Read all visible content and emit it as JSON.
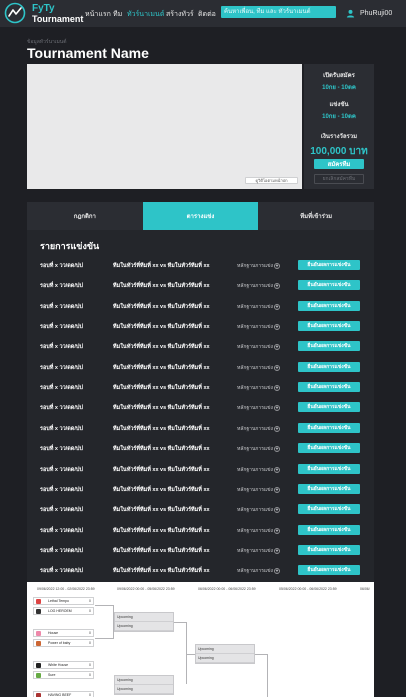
{
  "app": {
    "logo_line1": "FyTy",
    "logo_line2": "Tournament"
  },
  "nav": {
    "items": [
      {
        "label": "หน้าแรก"
      },
      {
        "label": "ทีม"
      },
      {
        "label": "ทัวร์นาเมนต์",
        "active": true
      },
      {
        "label": "สร้างทัวร์"
      },
      {
        "label": "ติดต่อ"
      }
    ],
    "search_placeholder": "ค้นหาเพื่อน, ทีม และ ทัวร์นาเมนต์",
    "username": "PhuRuji00"
  },
  "header": {
    "breadcrumb": "ข้อมูลทัวร์นาเมนต์",
    "title": "Tournament Name"
  },
  "media": {
    "watch_label": "ดูวิดีโอตามหน้าปก"
  },
  "info": {
    "open_label": "เปิดรับสมัคร",
    "open_value": "10กย - 10ตค",
    "compete_label": "แข่งขัน",
    "compete_value": "10กย - 10ตค",
    "prize_label": "เงินรางวัลรวม",
    "prize_value": "100,000 บาท",
    "apply_label": "สมัครทีม",
    "cancel_label": "ยกเลิกสมัครทีม"
  },
  "tabs": [
    {
      "label": "กฎกติกา"
    },
    {
      "label": "ตารางแข่ง",
      "active": true
    },
    {
      "label": "ทีมที่เข้าร่วม"
    }
  ],
  "schedule": {
    "title": "รายการแข่งขัน",
    "rows": [
      {
        "round": "รอบที่ x   วว/ดด/ปป",
        "teams": "ทีมในทัวร์ที่ทีมที่ xx  vs ทีมในทัวร์ทีมที่ xx",
        "evidence": "หลักฐานการแข่ง",
        "action": "ยืนยันผลการแข่งขัน"
      },
      {
        "round": "รอบที่ x   วว/ดด/ปป",
        "teams": "ทีมในทัวร์ที่ทีมที่ xx  vs ทีมในทัวร์ทีมที่ xx",
        "evidence": "หลักฐานการแข่ง",
        "action": "ยืนยันผลการแข่งขัน"
      },
      {
        "round": "รอบที่ x   วว/ดด/ปป",
        "teams": "ทีมในทัวร์ที่ทีมที่ xx  vs ทีมในทัวร์ทีมที่ xx",
        "evidence": "หลักฐานการแข่ง",
        "action": "ยืนยันผลการแข่งขัน"
      },
      {
        "round": "รอบที่ x   วว/ดด/ปป",
        "teams": "ทีมในทัวร์ที่ทีมที่ xx  vs ทีมในทัวร์ทีมที่ xx",
        "evidence": "หลักฐานการแข่ง",
        "action": "ยืนยันผลการแข่งขัน"
      },
      {
        "round": "รอบที่ x   วว/ดด/ปป",
        "teams": "ทีมในทัวร์ที่ทีมที่ xx  vs ทีมในทัวร์ทีมที่ xx",
        "evidence": "หลักฐานการแข่ง",
        "action": "ยืนยันผลการแข่งขัน"
      },
      {
        "round": "รอบที่ x   วว/ดด/ปป",
        "teams": "ทีมในทัวร์ที่ทีมที่ xx  vs ทีมในทัวร์ทีมที่ xx",
        "evidence": "หลักฐานการแข่ง",
        "action": "ยืนยันผลการแข่งขัน"
      },
      {
        "round": "รอบที่ x   วว/ดด/ปป",
        "teams": "ทีมในทัวร์ที่ทีมที่ xx  vs ทีมในทัวร์ทีมที่ xx",
        "evidence": "หลักฐานการแข่ง",
        "action": "ยืนยันผลการแข่งขัน"
      },
      {
        "round": "รอบที่ x   วว/ดด/ปป",
        "teams": "ทีมในทัวร์ที่ทีมที่ xx  vs ทีมในทัวร์ทีมที่ xx",
        "evidence": "หลักฐานการแข่ง",
        "action": "ยืนยันผลการแข่งขัน"
      },
      {
        "round": "รอบที่ x   วว/ดด/ปป",
        "teams": "ทีมในทัวร์ที่ทีมที่ xx  vs ทีมในทัวร์ทีมที่ xx",
        "evidence": "หลักฐานการแข่ง",
        "action": "ยืนยันผลการแข่งขัน"
      },
      {
        "round": "รอบที่ x   วว/ดด/ปป",
        "teams": "ทีมในทัวร์ที่ทีมที่ xx  vs ทีมในทัวร์ทีมที่ xx",
        "evidence": "หลักฐานการแข่ง",
        "action": "ยืนยันผลการแข่งขัน"
      },
      {
        "round": "รอบที่ x   วว/ดด/ปป",
        "teams": "ทีมในทัวร์ที่ทีมที่ xx  vs ทีมในทัวร์ทีมที่ xx",
        "evidence": "หลักฐานการแข่ง",
        "action": "ยืนยันผลการแข่งขัน"
      },
      {
        "round": "รอบที่ x   วว/ดด/ปป",
        "teams": "ทีมในทัวร์ที่ทีมที่ xx  vs ทีมในทัวร์ทีมที่ xx",
        "evidence": "หลักฐานการแข่ง",
        "action": "ยืนยันผลการแข่งขัน"
      },
      {
        "round": "รอบที่ x   วว/ดด/ปป",
        "teams": "ทีมในทัวร์ที่ทีมที่ xx  vs ทีมในทัวร์ทีมที่ xx",
        "evidence": "หลักฐานการแข่ง",
        "action": "ยืนยันผลการแข่งขัน"
      },
      {
        "round": "รอบที่ x   วว/ดด/ปป",
        "teams": "ทีมในทัวร์ที่ทีมที่ xx  vs ทีมในทัวร์ทีมที่ xx",
        "evidence": "หลักฐานการแข่ง",
        "action": "ยืนยันผลการแข่งขัน"
      },
      {
        "round": "รอบที่ x   วว/ดด/ปป",
        "teams": "ทีมในทัวร์ที่ทีมที่ xx  vs ทีมในทัวร์ทีมที่ xx",
        "evidence": "หลักฐานการแข่ง",
        "action": "ยืนยันผลการแข่งขัน"
      },
      {
        "round": "รอบที่ x   วว/ดด/ปป",
        "teams": "ทีมในทัวร์ที่ทีมที่ xx  vs ทีมในทัวร์ทีมที่ xx",
        "evidence": "หลักฐานการแข่ง",
        "action": "ยืนยันผลการแข่งขัน"
      }
    ]
  },
  "bracket": {
    "dates": [
      "09/06/2022 12:00 - 02/06/2022 23:59",
      "09/06/2022 00:00 - 05/06/2022 23:59",
      "06/06/2022 00:00 - 06/06/2022 23:59",
      "05/06/2022 00:00 - 06/06/2022 23:59",
      "06/06/"
    ],
    "teams": [
      {
        "name": "Lethal Tempo",
        "score": "0"
      },
      {
        "name": "LOG HEROEM",
        "score": "0"
      },
      {
        "name": "House",
        "score": "0"
      },
      {
        "name": "Power of baby",
        "score": "0"
      },
      {
        "name": "White House",
        "score": "0"
      },
      {
        "name": "Sure",
        "score": "0"
      },
      {
        "name": "HAVING BEEF",
        "score": "0"
      }
    ],
    "upcoming": "Upcoming"
  },
  "colors": {
    "accent": "#2ec4c8",
    "background": "#1e1f24",
    "panel": "#2b2d33"
  }
}
